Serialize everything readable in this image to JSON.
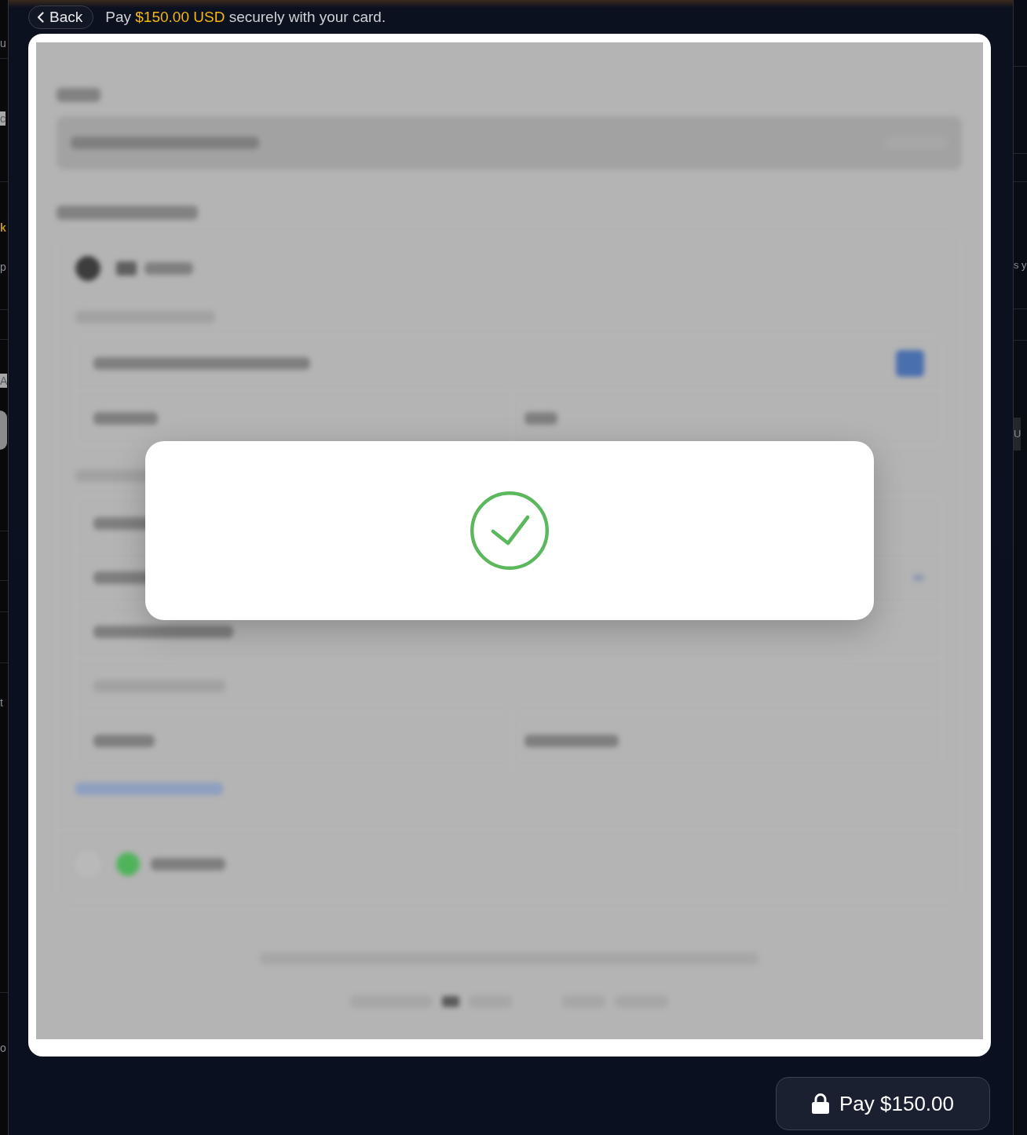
{
  "backdrop": {
    "left_fragments": [
      {
        "text": "u",
        "kind": "plain"
      },
      {
        "text": "c",
        "kind": "faint"
      },
      {
        "text": "k",
        "kind": "accent"
      },
      {
        "text": "p",
        "kind": "plain"
      },
      {
        "text": "A",
        "kind": "faint"
      },
      {
        "text": "t",
        "kind": "plain"
      },
      {
        "text": "o",
        "kind": "plain"
      }
    ],
    "right_fragments": [
      {
        "text": "s y",
        "kind": "plain"
      },
      {
        "text": "U",
        "kind": "chip"
      }
    ]
  },
  "header": {
    "back_button": "Back",
    "subtitle": {
      "before": "Pay",
      "amount": "$150.00 USD",
      "after": "securely with your card."
    }
  },
  "pay_button": {
    "label": "Pay $150.00"
  }
}
